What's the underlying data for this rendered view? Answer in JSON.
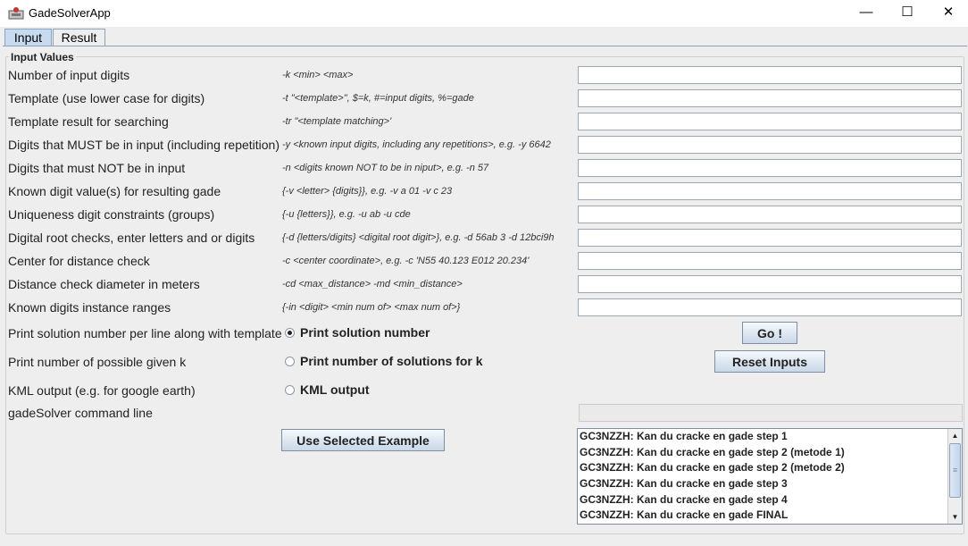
{
  "window": {
    "title": "GadeSolverApp",
    "minimize": "—",
    "maximize": "☐",
    "close": "✕"
  },
  "tabs": [
    {
      "label": "Input",
      "active": true
    },
    {
      "label": "Result",
      "active": false
    }
  ],
  "group_title": "Input Values",
  "fields": [
    {
      "label": "Number of input digits",
      "hint": "-k <min> <max>",
      "value": ""
    },
    {
      "label": "Template (use lower case for digits)",
      "hint": "-t \"<template>\", $=k, #=input digits, %=gade",
      "value": ""
    },
    {
      "label": "Template result for searching",
      "hint": "-tr \"<template matching>'",
      "value": ""
    },
    {
      "label": "Digits that MUST be in input (including repetition)",
      "hint": "-y <known input digits, including any repetitions>, e.g. -y 6642",
      "value": ""
    },
    {
      "label": "Digits that must NOT be in input",
      "hint": "-n <digits known NOT to be in niput>, e.g. -n 57",
      "value": ""
    },
    {
      "label": "Known digit value(s) for resulting gade",
      "hint": "{-v <letter> {digits}}, e.g. -v a 01 -v c 23",
      "value": ""
    },
    {
      "label": "Uniqueness digit constraints (groups)",
      "hint": "{-u {letters}}, e.g. -u ab -u cde",
      "value": ""
    },
    {
      "label": "Digital root checks, enter letters and or digits",
      "hint": "{-d {letters/digits} <digital root digit>}, e.g.  -d 56ab 3 -d 12bci9h 8",
      "value": ""
    },
    {
      "label": "Center for distance check",
      "hint": "-c <center coordinate>, e.g. -c 'N55 40.123 E012 20.234'",
      "value": ""
    },
    {
      "label": "Distance check diameter in meters",
      "hint": "-cd <max_distance> -md <min_distance>",
      "value": ""
    },
    {
      "label": "Known digits instance ranges",
      "hint": "{-in <digit> <min num of> <max num of>}",
      "value": ""
    }
  ],
  "options": [
    {
      "label": "Print solution number per line along with template",
      "radio": "Print solution number",
      "selected": true
    },
    {
      "label": "Print number of possible given k",
      "radio": "Print number of solutions for k",
      "selected": false
    },
    {
      "label": "KML output (e.g. for google earth)",
      "radio": "KML output",
      "selected": false
    }
  ],
  "command_line_label": "gadeSolver command line",
  "command_line_value": "",
  "buttons": {
    "go": "Go !",
    "reset": "Reset Inputs",
    "use_example": "Use Selected Example"
  },
  "examples": [
    "GC3NZZH: Kan du cracke en gade step 1",
    "GC3NZZH: Kan du cracke en gade step 2 (metode 1)",
    "GC3NZZH: Kan du cracke en gade step 2 (metode 2)",
    "GC3NZZH: Kan du cracke en gade step 3",
    "GC3NZZH: Kan du cracke en gade step 4",
    "GC3NZZH: Kan du cracke en gade FINAL"
  ],
  "scroll": {
    "up": "▲",
    "down": "▼",
    "grip": "≡"
  }
}
